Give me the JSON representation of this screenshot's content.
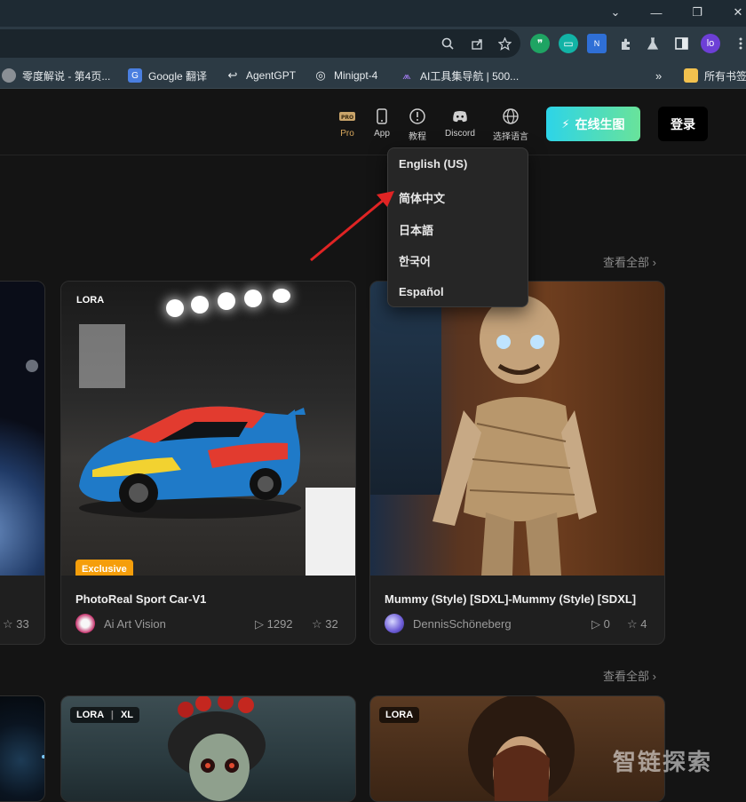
{
  "browser": {
    "window_controls": {
      "minimize": "—",
      "restore": "❐",
      "close": "✕",
      "chevron": "⌄"
    },
    "profile_initials": "lo",
    "bookmarks": [
      {
        "label": "零度解说 - 第4页..."
      },
      {
        "label": "Google 翻译"
      },
      {
        "label": "AgentGPT"
      },
      {
        "label": "Minigpt-4"
      },
      {
        "label": "AI工具集导航 | 500..."
      }
    ],
    "bookmarks_more": "»",
    "all_bookmarks": "所有书签"
  },
  "nav": {
    "pro_label": "Pro",
    "app_label": "App",
    "tutorial_label": "教程",
    "discord_label": "Discord",
    "language_label": "选择语言",
    "online_button": "在线生图",
    "login_button": "登录"
  },
  "language_menu": {
    "options": [
      "English (US)",
      "简体中文",
      "日本語",
      "한국어",
      "Español"
    ]
  },
  "sections": [
    {
      "view_all": "查看全部 ›"
    },
    {
      "view_all": "查看全部 ›"
    }
  ],
  "cards_row1": [
    {
      "stars": "33"
    },
    {
      "tag": "LORA",
      "exclusive": "Exclusive",
      "title": "PhotoReal Sport Car-V1",
      "author": "Ai Art Vision",
      "runs": "1292",
      "stars": "32"
    },
    {
      "tag": "LORA",
      "title": "Mummy (Style) [SDXL]-Mummy (Style) [SDXL]",
      "author": "DennisSchöneberg",
      "runs": "0",
      "stars": "4"
    }
  ],
  "cards_row2": [
    {
      "tag": "LORA",
      "tag2": "XL"
    },
    {
      "tag": "LORA"
    }
  ],
  "watermark": "智链探索",
  "colors": {
    "accent_gradient_start": "#2dd4e8",
    "accent_gradient_end": "#69e39a",
    "exclusive": "#f59e0b",
    "arrow": "#e02424"
  }
}
